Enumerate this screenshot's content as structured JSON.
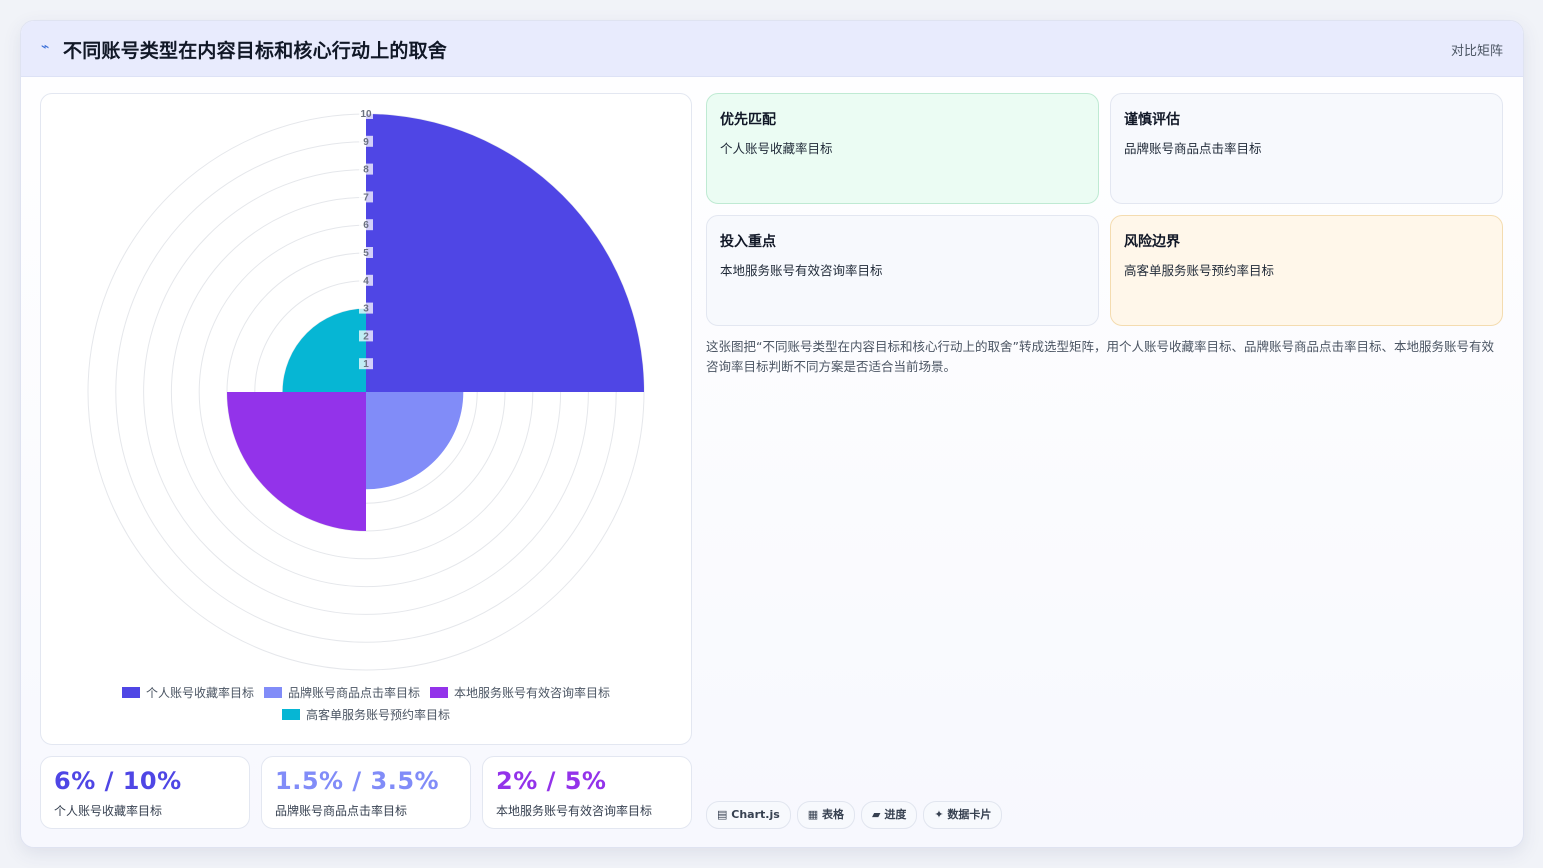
{
  "header": {
    "title": "不同账号类型在内容目标和核心行动上的取舍",
    "tag": "对比矩阵",
    "logo_icon": "trend-line-icon"
  },
  "chart_data": {
    "type": "polarArea",
    "r_range": [
      0,
      10
    ],
    "r_ticks": [
      "1",
      "2",
      "3",
      "4",
      "5",
      "6",
      "7",
      "8",
      "9",
      "10"
    ],
    "grid": true,
    "legend_position": "bottom",
    "series": [
      {
        "name": "个人账号收藏率目标",
        "value": 10,
        "color": "#4f46e5"
      },
      {
        "name": "品牌账号商品点击率目标",
        "value": 3.5,
        "color": "#818cf8"
      },
      {
        "name": "本地服务账号有效咨询率目标",
        "value": 5,
        "color": "#9333ea"
      },
      {
        "name": "高客单服务账号预约率目标",
        "value": 3,
        "color": "#06b6d4"
      }
    ]
  },
  "stats": [
    {
      "value": "6% / 10%",
      "label": "个人账号收藏率目标",
      "color": "#4f46e5"
    },
    {
      "value": "1.5% / 3.5%",
      "label": "品牌账号商品点击率目标",
      "color": "#818cf8"
    },
    {
      "value": "2% / 5%",
      "label": "本地服务账号有效咨询率目标",
      "color": "#9333ea"
    }
  ],
  "tiles": [
    {
      "title": "优先匹配",
      "subtitle": "个人账号收藏率目标",
      "bg": "#ebfcf3",
      "border": "#bfead3"
    },
    {
      "title": "谨慎评估",
      "subtitle": "品牌账号商品点击率目标",
      "bg": "#f7f9fd",
      "border": "#e3e7f1"
    },
    {
      "title": "投入重点",
      "subtitle": "本地服务账号有效咨询率目标",
      "bg": "#f7f9fd",
      "border": "#e3e7f1"
    },
    {
      "title": "风险边界",
      "subtitle": "高客单服务账号预约率目标",
      "bg": "#fff7ea",
      "border": "#f4dcb0"
    }
  ],
  "description": "这张图把“不同账号类型在内容目标和核心行动上的取舍”转成选型矩阵，用个人账号收藏率目标、品牌账号商品点击率目标、本地服务账号有效咨询率目标判断不同方案是否适合当前场景。",
  "pills": [
    {
      "icon": "chart-icon",
      "glyph": "▤",
      "label": "Chart.js"
    },
    {
      "icon": "table-icon",
      "glyph": "▦",
      "label": "表格"
    },
    {
      "icon": "progress-icon",
      "glyph": "▰",
      "label": "进度"
    },
    {
      "icon": "sparkle-icon",
      "glyph": "✦",
      "label": "数据卡片"
    }
  ]
}
